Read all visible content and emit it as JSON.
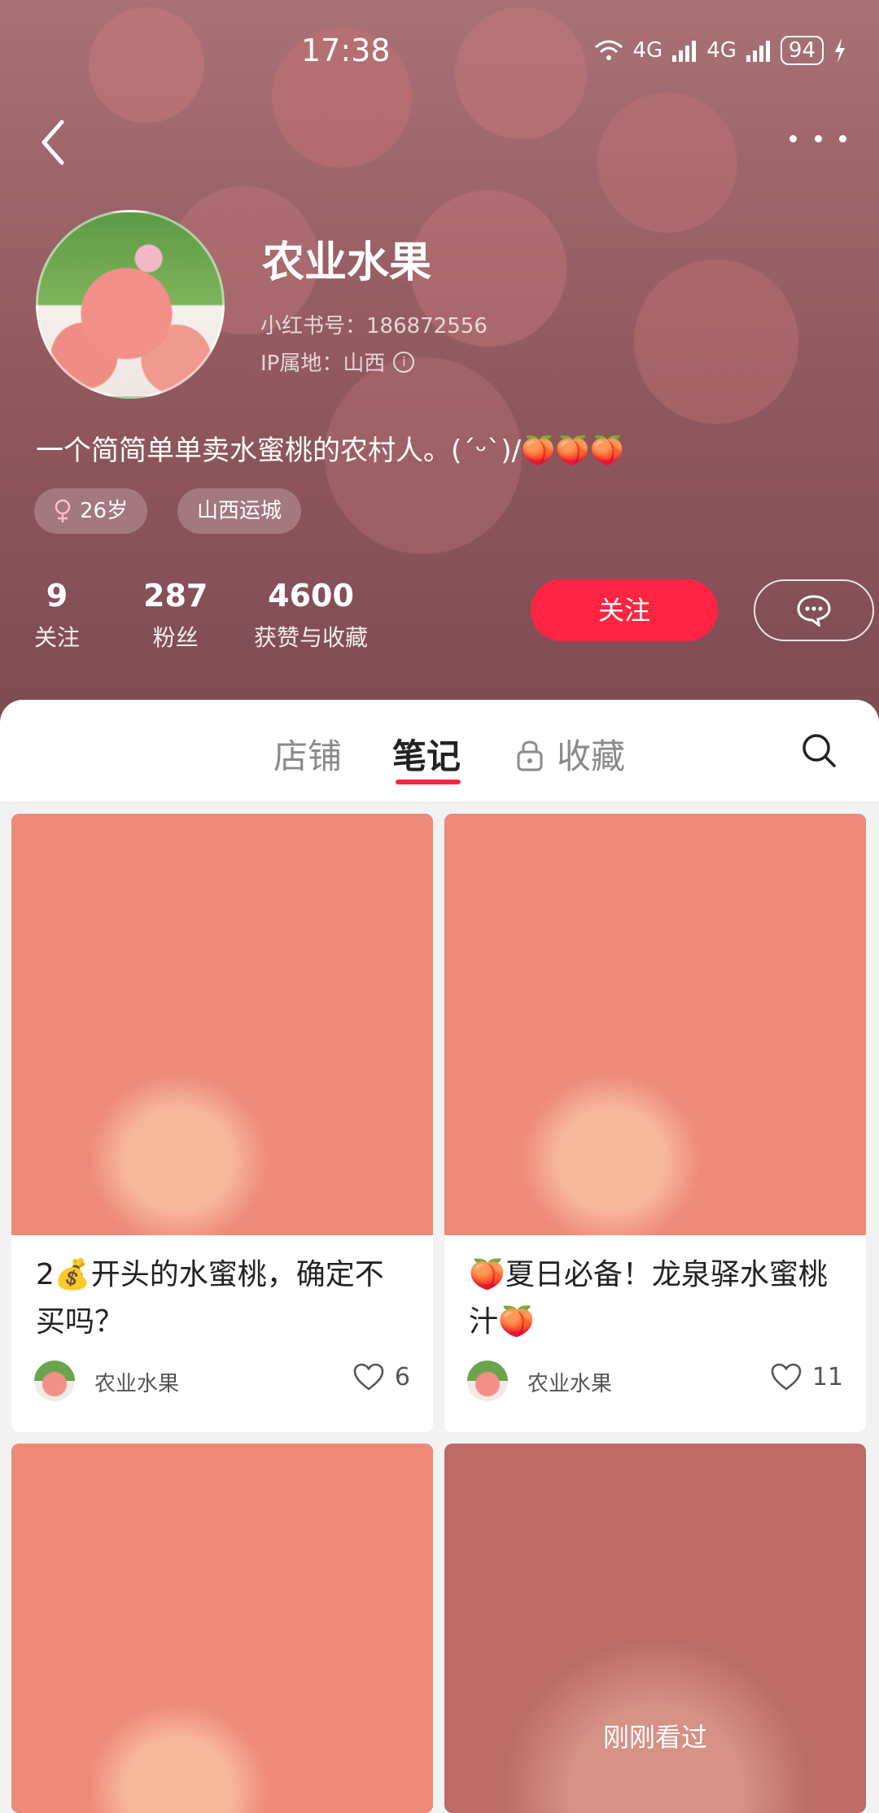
{
  "status_bar": {
    "time": "17:38",
    "network_1": "4G",
    "network_2": "4G",
    "battery": "94"
  },
  "profile": {
    "name": "农业水果",
    "red_id": "小红书号：186872556",
    "ip_location": "IP属地：山西",
    "bio": "一个简简单单卖水蜜桃的农村人。(ˊᵕˋ)/🍑🍑🍑",
    "tags": {
      "age": "26岁",
      "location": "山西运城"
    },
    "stats": [
      {
        "value": "9",
        "label": "关注"
      },
      {
        "value": "287",
        "label": "粉丝"
      },
      {
        "value": "4600",
        "label": "获赞与收藏"
      }
    ],
    "follow_label": "关注"
  },
  "tabs": {
    "shop": "店铺",
    "notes": "笔记",
    "favorites": "收藏"
  },
  "posts": [
    {
      "title": "2💰开头的水蜜桃，确定不买吗？",
      "author": "农业水果",
      "likes": "6"
    },
    {
      "title": "🍑夏日必备！龙泉驿水蜜桃汁🍑",
      "author": "农业水果",
      "likes": "11"
    },
    {
      "title": "",
      "author": "",
      "likes": ""
    },
    {
      "title": "",
      "author": "",
      "likes": "",
      "overlay": "刚刚看过"
    }
  ],
  "colors": {
    "accent": "#ff2442"
  },
  "icons": [
    "back-arrow-icon",
    "more-icon",
    "info-icon",
    "female-icon",
    "chat-icon",
    "lock-icon",
    "search-icon",
    "heart-icon"
  ]
}
